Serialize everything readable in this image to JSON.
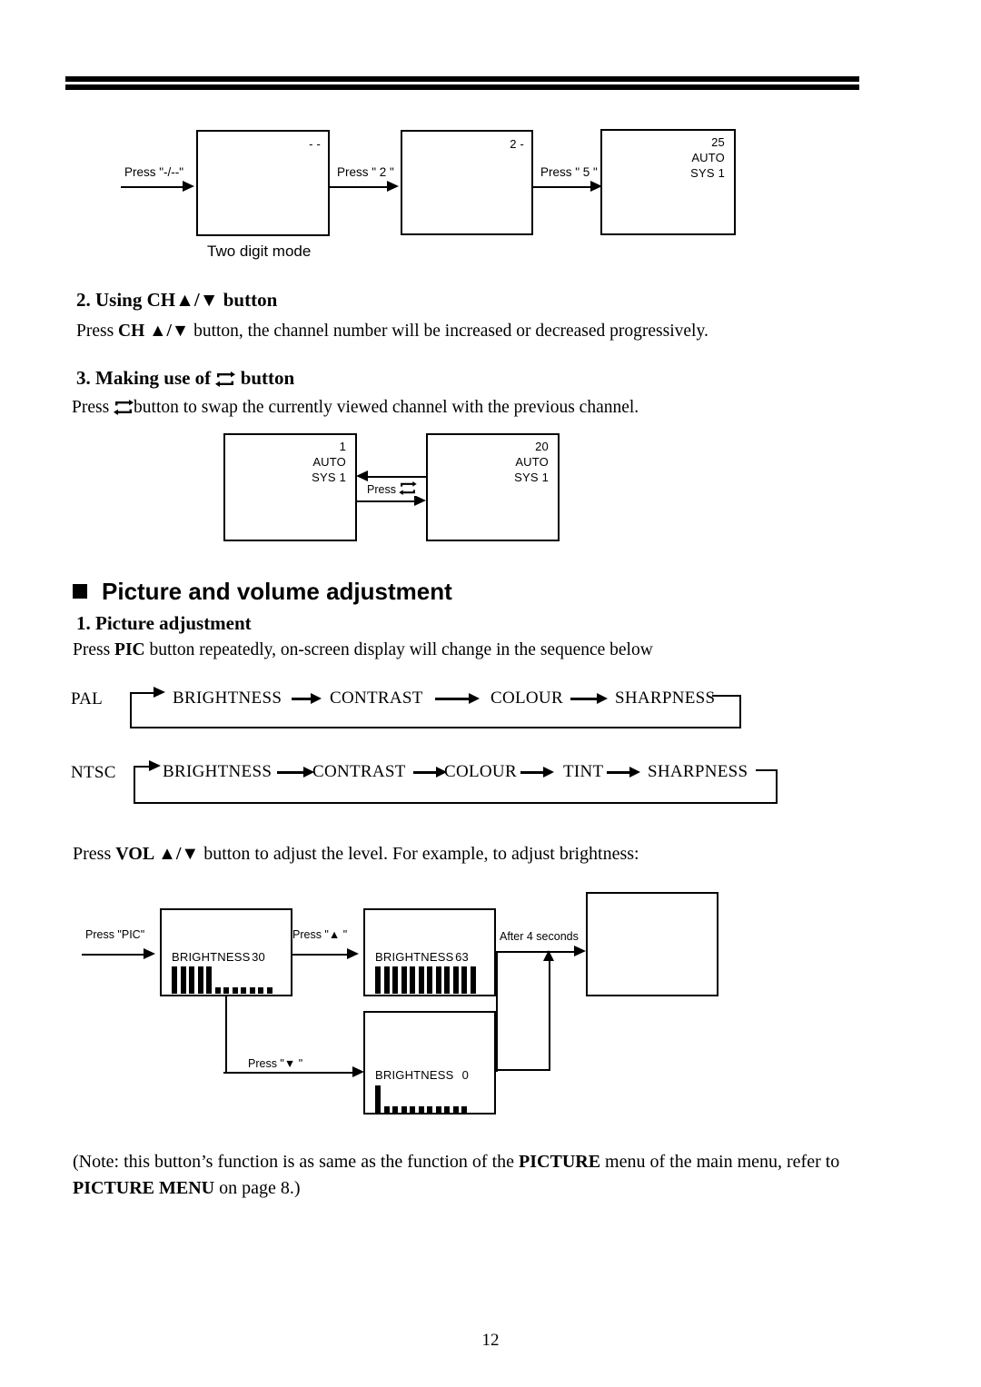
{
  "page": {
    "number": "12"
  },
  "diagram_two_digit": {
    "steps": [
      {
        "label": "Press \"-/--\""
      },
      {
        "label": "Press \" 2 \""
      },
      {
        "label": "Press \" 5 \""
      }
    ],
    "screens": [
      {
        "osd": "- -",
        "caption": "Two digit mode"
      },
      {
        "osd": "2 -"
      },
      {
        "osd_line1": "25",
        "osd_line2": "AUTO",
        "osd_line3": "SYS 1"
      }
    ]
  },
  "section2": {
    "heading": "2. Using CH▲/▼ button",
    "body_before": "Press ",
    "body_bold": "CH ▲/▼",
    "body_after": " button, the channel number will be increased or decreased progressively."
  },
  "section3": {
    "heading_before": "3. Making use of",
    "heading_after": "button",
    "body_before": "Press",
    "body_after": "button to swap the currently viewed channel with the previous channel."
  },
  "diagram_swap": {
    "press_label": "Press",
    "screen_left": {
      "line1": "1",
      "line2": "AUTO",
      "line3": "SYS 1"
    },
    "screen_right": {
      "line1": "20",
      "line2": "AUTO",
      "line3": "SYS 1"
    }
  },
  "picture_section": {
    "heading": "Picture and volume adjustment",
    "sub_heading": "1. Picture adjustment",
    "intro_before": "Press ",
    "intro_bold": "PIC",
    "intro_after": " button repeatedly, on-screen display will change in the sequence below"
  },
  "sequences": [
    {
      "system": "PAL",
      "items": [
        "BRIGHTNESS",
        "CONTRAST",
        "COLOUR",
        "SHARPNESS"
      ]
    },
    {
      "system": "NTSC",
      "items": [
        "BRIGHTNESS",
        "CONTRAST",
        "COLOUR",
        "TINT",
        "SHARPNESS"
      ]
    }
  ],
  "vol_intro": {
    "before": "Press ",
    "bold": "VOL ▲/▼",
    "after": " button to adjust the level. For example, to adjust brightness:"
  },
  "diagram_brightness": {
    "labels": {
      "press_pic": "Press \"PIC\"",
      "press_up": "Press \"▲ \"",
      "press_down": "Press \"▼ \"",
      "after_4s": "After 4 seconds"
    },
    "screens": [
      {
        "name": "BRIGHTNESS",
        "value": "30",
        "tall_bars": 5,
        "dots": 7
      },
      {
        "name": "BRIGHTNESS",
        "value": "63",
        "tall_bars": 12,
        "dots": 0
      },
      {
        "name": "BRIGHTNESS",
        "value": "0",
        "tall_bars": 1,
        "dots": 10
      },
      {
        "blank": true
      }
    ]
  },
  "note": {
    "line1_a": "(Note: this button’s function is as same as the function of the ",
    "line1_bold": "PICTURE",
    "line1_b": " menu of the main menu,",
    "line2_a": "refer to ",
    "line2_bold": "PICTURE MENU",
    "line2_b": " on  page 8.)"
  }
}
